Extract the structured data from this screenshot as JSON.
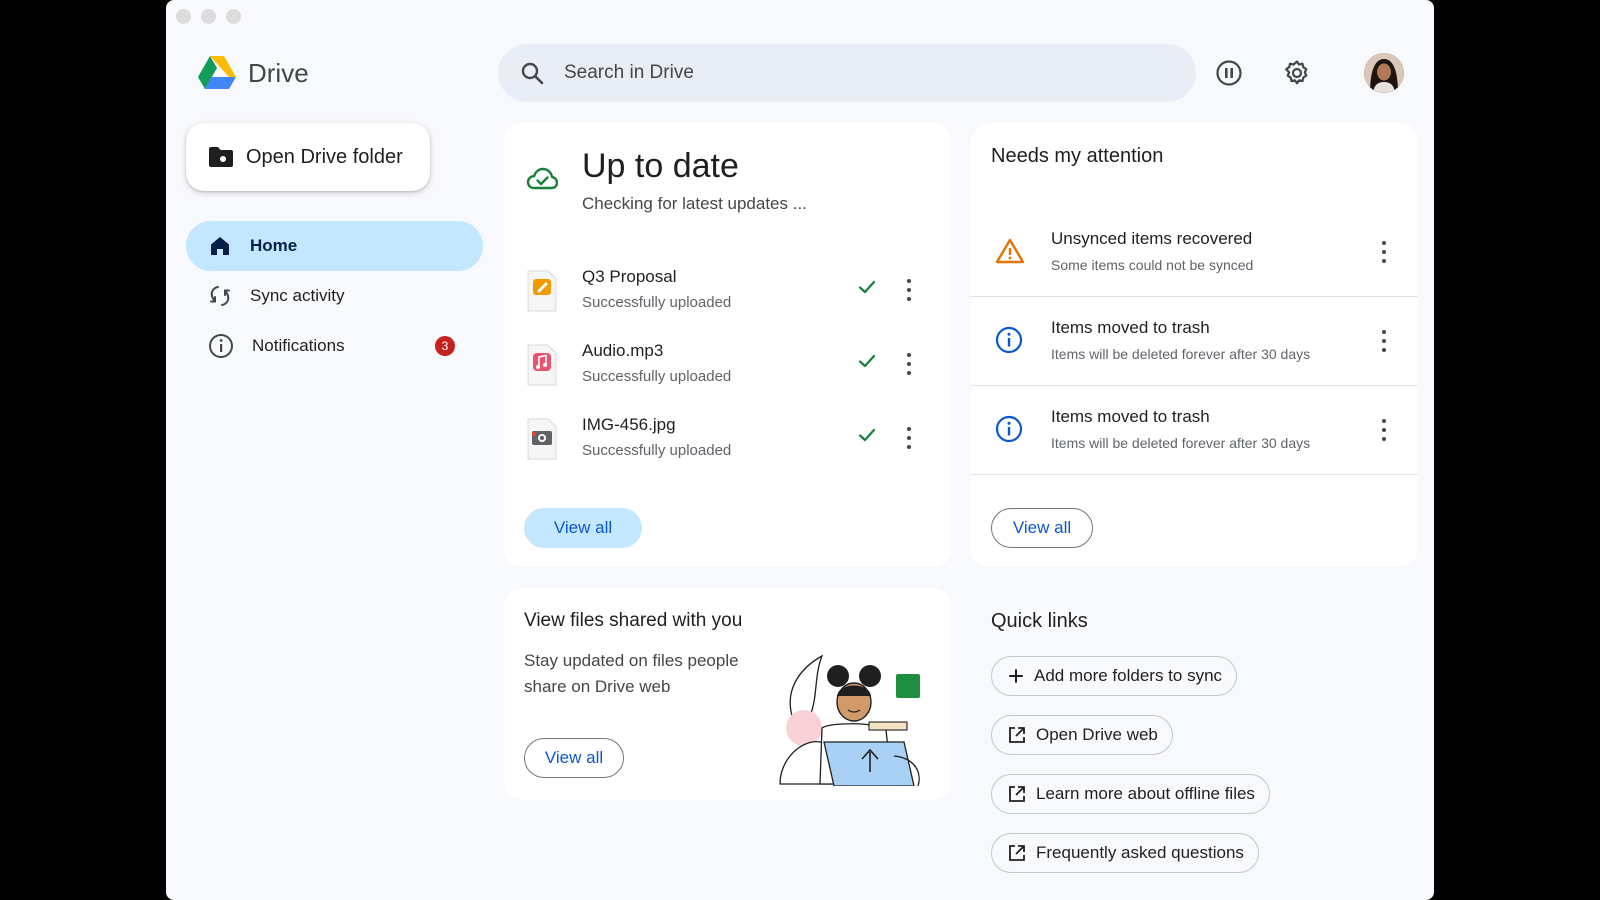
{
  "app": {
    "title": "Drive"
  },
  "search": {
    "placeholder": "Search in Drive"
  },
  "sidebar": {
    "open_folder_label": "Open Drive folder",
    "items": [
      {
        "label": "Home",
        "icon": "home-icon",
        "active": true
      },
      {
        "label": "Sync activity",
        "icon": "sync-icon"
      },
      {
        "label": "Notifications",
        "icon": "info-icon",
        "badge": "3"
      }
    ]
  },
  "status": {
    "title": "Up to date",
    "subtitle": "Checking for latest updates ...",
    "files": [
      {
        "name": "Q3 Proposal",
        "status": "Successfully uploaded",
        "type": "pages",
        "color": "#f29900"
      },
      {
        "name": "Audio.mp3",
        "status": "Successfully uploaded",
        "type": "mp3",
        "color": "#e8546f"
      },
      {
        "name": "IMG-456.jpg",
        "status": "Successfully uploaded",
        "type": "jpg",
        "color": "#5f6368"
      }
    ],
    "view_all": "View all"
  },
  "attention": {
    "title": "Needs my attention",
    "items": [
      {
        "title": "Unsynced items recovered",
        "subtitle": "Some items could not be synced",
        "icon": "warning-icon"
      },
      {
        "title": "Items moved to trash",
        "subtitle": "Items will be deleted forever after 30 days",
        "icon": "info-icon"
      },
      {
        "title": "Items moved to trash",
        "subtitle": "Items will be deleted forever after 30 days",
        "icon": "info-icon"
      }
    ],
    "view_all": "View all"
  },
  "shared": {
    "title": "View files shared with you",
    "text": "Stay updated on files people share on Drive web",
    "view_all": "View all"
  },
  "quick_links": {
    "title": "Quick links",
    "items": [
      {
        "label": "Add more folders to sync",
        "icon": "plus-icon"
      },
      {
        "label": "Open Drive web",
        "icon": "open-external-icon"
      },
      {
        "label": "Learn more about offline files",
        "icon": "open-external-icon"
      },
      {
        "label": "Frequently asked questions",
        "icon": "open-external-icon"
      }
    ]
  },
  "colors": {
    "accent": "#0b57d0",
    "active_nav": "#c2e7ff",
    "success": "#188038",
    "warning": "#e37400",
    "badge": "#c5221f"
  }
}
